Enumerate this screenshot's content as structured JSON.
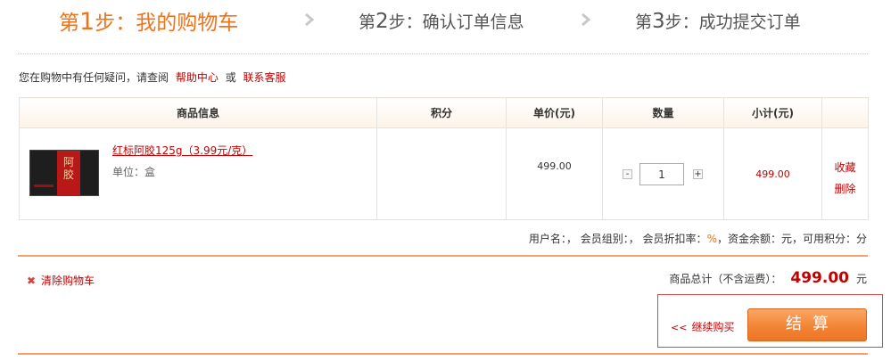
{
  "steps": [
    {
      "prefix": "第",
      "num": "1",
      "suffix": "步：我的购物车"
    },
    {
      "prefix": "第",
      "num": "2",
      "suffix": "步：确认订单信息"
    },
    {
      "prefix": "第",
      "num": "3",
      "suffix": "步：成功提交订单"
    }
  ],
  "notice": {
    "text": "您在购物中有任何疑问，请查阅",
    "help_link": "帮助中心",
    "or": "或",
    "service_link": "联系客服"
  },
  "table": {
    "headers": [
      "商品信息",
      "积分",
      "单价(元)",
      "数量",
      "小计(元)",
      ""
    ],
    "rows": [
      {
        "name": "红标阿胶125g（3.99元/克）",
        "unit": "单位：盒",
        "points": "",
        "price": "499.00",
        "quantity": "1",
        "subtotal": "499.00",
        "actions": [
          "收藏",
          "删除"
        ]
      }
    ]
  },
  "image": {
    "box_text": "阿胶"
  },
  "user_info": {
    "username": "用户名：，",
    "group": "会员组别：，",
    "discount_label": "会员折扣率：",
    "discount_value": "%",
    "balance": "，资金余额：元，",
    "points": "可用积分：分"
  },
  "footer": {
    "clear_cart": "清除购物车",
    "total_label": "商品总计（不含运费）：",
    "total_amount": "499.00",
    "currency": "元",
    "continue": "继续购买",
    "checkout": "结算"
  },
  "icons": {
    "step_arrow": "chevron-right-icon",
    "clear": "close-icon",
    "continue": "double-chevron-left-icon"
  },
  "colors": {
    "accent": "#f0731c",
    "link_red": "#c40000",
    "checkout_orange": "#f28535"
  }
}
